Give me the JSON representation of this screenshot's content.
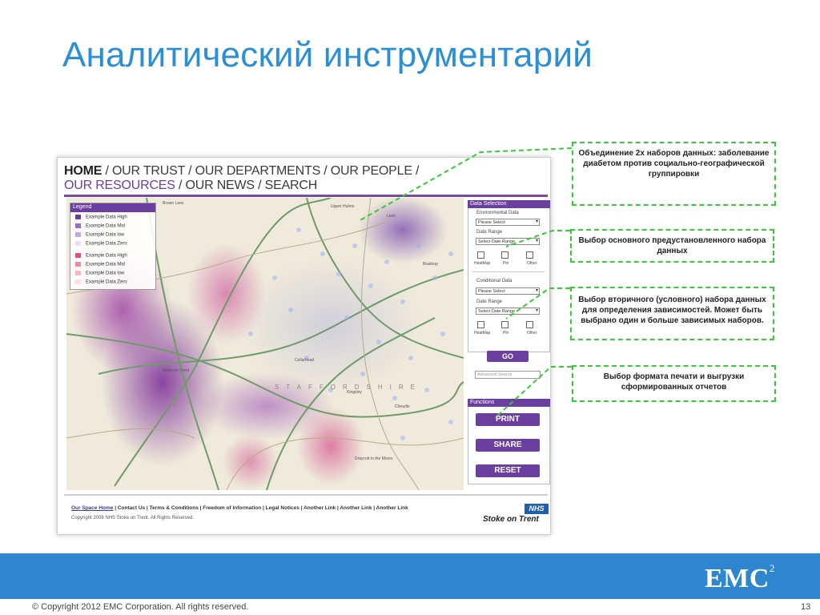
{
  "slide": {
    "title": "Аналитический инструментарий",
    "copyright": "© Copyright 2012 EMC Corporation. All rights reserved.",
    "page_number": "13",
    "logo_text": "EMC",
    "logo_sup": "2",
    "colors": {
      "title": "#2b8fd6",
      "band": "#2e86cf",
      "callout_border": "#33cc33"
    }
  },
  "callouts": [
    "Объединение 2х  наборов данных: заболевание диабетом против социально-географической группировки",
    "Выбор основного предустановленного набора данных",
    "Выбор вторичного (условного) набора данных для определения зависимостей. Может быть выбрано один и больше зависимых наборов.",
    "Выбор формата печати и выгрузки сформированных  отчетов"
  ],
  "site": {
    "nav_line1": {
      "home": "HOME",
      "rest": " / OUR TRUST / OUR DEPARTMENTS / OUR PEOPLE /"
    },
    "nav_line2": {
      "resources": "OUR RESOURCES",
      "rest": " / OUR NEWS / SEARCH"
    },
    "accent": "#6b3fa0",
    "legend": {
      "title": "Legend",
      "items": [
        {
          "label": "Example Data High",
          "color": "#6b3fa0"
        },
        {
          "label": "Example Data Mid",
          "color": "#9b6fc8"
        },
        {
          "label": "Example Data low",
          "color": "#c0a8e0"
        },
        {
          "label": "Example Data Zero",
          "color": "#e8e0f4"
        },
        {
          "label": "Example Data High",
          "color": "#e0507a"
        },
        {
          "label": "Example Data Mid",
          "color": "#ec8ca0"
        },
        {
          "label": "Example Data low",
          "color": "#f4b8c4"
        },
        {
          "label": "Example Data Zero",
          "color": "#f8e0e4"
        }
      ]
    },
    "map_labels": [
      "Brown Lees",
      "Stoke-on-Trent",
      "Kingsley",
      "Cheadle",
      "Draycott in the Moors",
      "Leek",
      "Cellarhead",
      "Bradnop",
      "Upper Hulme"
    ],
    "map_region": "STAFFORDSHIRE",
    "data_selection": {
      "title": "Data Selection",
      "env_label": "Environmental Data",
      "env_value": "Please Select",
      "date_label": "Date Range",
      "date_value": "Select Date Range",
      "cond_label": "Conditional Data",
      "cond_value": "Please Select",
      "date2_label": "Date Range",
      "date2_value": "Select Date Range",
      "checks": [
        "HeatMap",
        "Pin",
        "Other"
      ],
      "go": "GO",
      "search_placeholder": "Advanced Search"
    },
    "functions": {
      "title": "Functions",
      "print": "PRINT",
      "share": "SHARE",
      "reset": "RESET"
    },
    "footer_links": {
      "first": "Our Space Home",
      "rest": " | Contact Us | Terms & Conditions | Freedom of Information | Legal Notices | Another Link | Another Link | Another Link"
    },
    "footer_copyright": "Copyright 2008 NHS Stoke on Trent. All Rights Reserved.",
    "nhs_badge": "NHS",
    "brand": "Stoke on Trent"
  }
}
